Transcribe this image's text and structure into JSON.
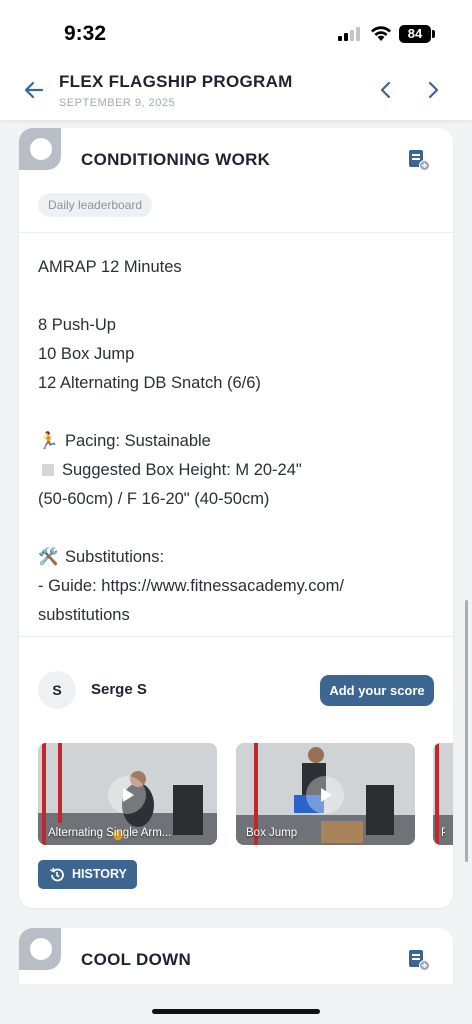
{
  "status_bar": {
    "time": "9:32",
    "battery": "84"
  },
  "header": {
    "title": "FLEX FLAGSHIP PROGRAM",
    "date": "SEPTEMBER 9, 2025",
    "icons": {
      "back": "arrow-left-icon",
      "prev": "chevron-left-icon",
      "next": "chevron-right-icon"
    }
  },
  "sections": [
    {
      "title": "CONDITIONING WORK",
      "chip": "Daily leaderboard",
      "workout_lines": [
        "AMRAP 12 Minutes",
        "",
        "8 Push-Up",
        "10 Box Jump",
        "12 Alternating DB Snatch (6/6)",
        "",
        "Pacing: Sustainable",
        "Suggested Box Height: M 20-24\"",
        "(50-60cm) / F 16-20\" (40-50cm)",
        "",
        "Substitutions:",
        "- Guide: https://www.fitnessacademy.com/",
        "substitutions"
      ],
      "emojis": {
        "pacing": "🏃",
        "substitutions": "🛠️"
      },
      "user": {
        "initial": "S",
        "name": "Serge S"
      },
      "score_button": "Add your score",
      "videos": [
        {
          "label": "Alternating Single Arm..."
        },
        {
          "label": "Box Jump"
        },
        {
          "label": "P"
        }
      ],
      "history_button": "HISTORY"
    },
    {
      "title": "COOL DOWN"
    }
  ],
  "colors": {
    "accent": "#3c6590",
    "badge": "#b7bec6",
    "background": "#f1f3f5"
  }
}
